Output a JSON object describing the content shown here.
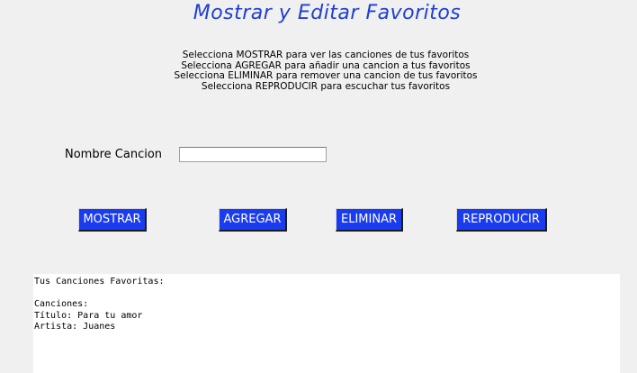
{
  "title": "Mostrar y Editar Favoritos",
  "instructions": [
    "Selecciona MOSTRAR para ver las canciones de tus favoritos",
    "Selecciona AGREGAR para añadir una cancion a tus favoritos",
    "Selecciona ELIMINAR para remover una cancion de tus favoritos",
    "Selecciona REPRODUCIR para escuchar tus favoritos"
  ],
  "form": {
    "song_name_label": "Nombre Cancion",
    "song_name_value": "",
    "song_name_placeholder": ""
  },
  "buttons": {
    "mostrar": "MOSTRAR",
    "agregar": "AGREGAR",
    "eliminar": "ELIMINAR",
    "reproducir": "REPRODUCIR"
  },
  "output": {
    "header": "Tus Canciones Favoritas:",
    "blank": "",
    "songs_label": "Canciones:",
    "title_line": "Título: Para tu amor",
    "artist_line": "Artista: Juanes"
  },
  "colors": {
    "title": "#1f3fd1",
    "button_bg": "#1a3cf0",
    "button_text": "#ffffff",
    "window_bg": "#f0f0f0"
  }
}
